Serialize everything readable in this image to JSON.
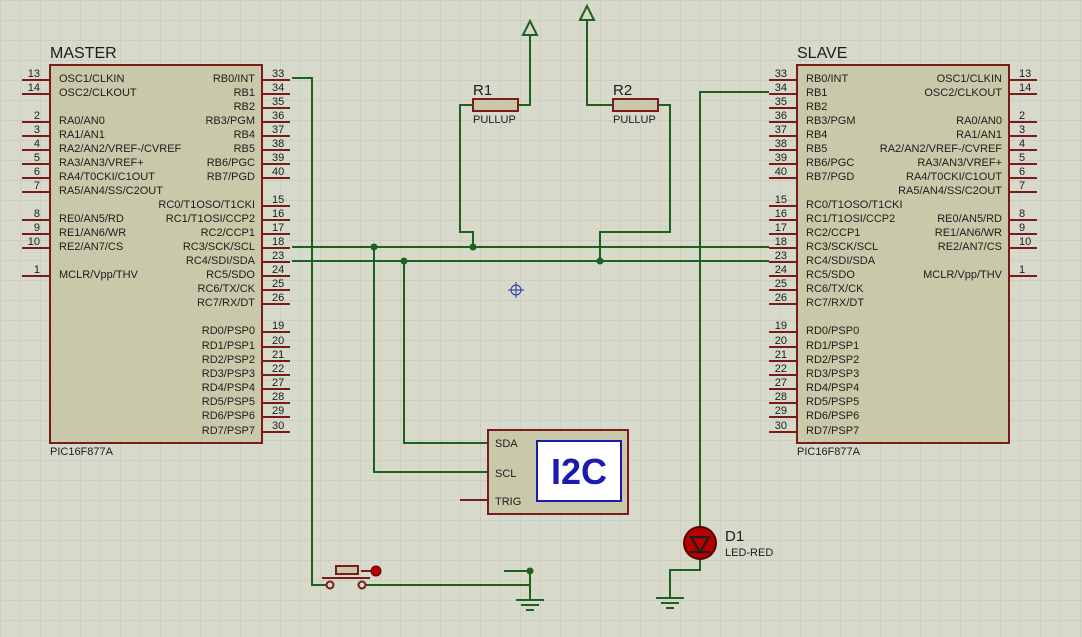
{
  "master": {
    "name": "MASTER",
    "part": "PIC16F877A",
    "left_pins": [
      {
        "num": "13",
        "label": "OSC1/CLKIN",
        "bar": false
      },
      {
        "num": "14",
        "label": "OSC2/CLKOUT",
        "bar": false
      },
      {
        "num": "2",
        "label": "RA0/AN0",
        "bar": false
      },
      {
        "num": "3",
        "label": "RA1/AN1",
        "bar": false
      },
      {
        "num": "4",
        "label": "RA2/AN2/VREF-/CVREF",
        "bar": false
      },
      {
        "num": "5",
        "label": "RA3/AN3/VREF+",
        "bar": false
      },
      {
        "num": "6",
        "label": "RA4/T0CKI/C1OUT",
        "bar": false
      },
      {
        "num": "7",
        "label": "RA5/AN4/SS/C2OUT",
        "bar": false
      },
      {
        "num": "8",
        "label": "RE0/AN5/RD",
        "bar": false
      },
      {
        "num": "9",
        "label": "RE1/AN6/WR",
        "bar": false
      },
      {
        "num": "10",
        "label": "RE2/AN7/CS",
        "bar": false
      },
      {
        "num": "1",
        "label": "MCLR/Vpp/THV",
        "bar": false
      }
    ],
    "right_pins": [
      {
        "num": "33",
        "label": "RB0/INT"
      },
      {
        "num": "34",
        "label": "RB1"
      },
      {
        "num": "35",
        "label": "RB2"
      },
      {
        "num": "36",
        "label": "RB3/PGM"
      },
      {
        "num": "37",
        "label": "RB4"
      },
      {
        "num": "38",
        "label": "RB5"
      },
      {
        "num": "39",
        "label": "RB6/PGC"
      },
      {
        "num": "40",
        "label": "RB7/PGD"
      },
      {
        "num": "15",
        "label": "RC0/T1OSO/T1CKI"
      },
      {
        "num": "16",
        "label": "RC1/T1OSI/CCP2"
      },
      {
        "num": "17",
        "label": "RC2/CCP1"
      },
      {
        "num": "18",
        "label": "RC3/SCK/SCL"
      },
      {
        "num": "23",
        "label": "RC4/SDI/SDA"
      },
      {
        "num": "24",
        "label": "RC5/SDO"
      },
      {
        "num": "25",
        "label": "RC6/TX/CK"
      },
      {
        "num": "26",
        "label": "RC7/RX/DT"
      },
      {
        "num": "19",
        "label": "RD0/PSP0"
      },
      {
        "num": "20",
        "label": "RD1/PSP1"
      },
      {
        "num": "21",
        "label": "RD2/PSP2"
      },
      {
        "num": "22",
        "label": "RD3/PSP3"
      },
      {
        "num": "27",
        "label": "RD4/PSP4"
      },
      {
        "num": "28",
        "label": "RD5/PSP5"
      },
      {
        "num": "29",
        "label": "RD6/PSP6"
      },
      {
        "num": "30",
        "label": "RD7/PSP7"
      }
    ]
  },
  "slave": {
    "name": "SLAVE",
    "part": "PIC16F877A"
  },
  "resistors": [
    {
      "ref": "R1",
      "value": "PULLUP"
    },
    {
      "ref": "R2",
      "value": "PULLUP"
    }
  ],
  "i2c": {
    "title": "I2C",
    "pins": [
      "SDA",
      "SCL",
      "TRIG"
    ]
  },
  "led": {
    "ref": "D1",
    "value": "LED-RED"
  },
  "colors": {
    "background": "#d7d9cb",
    "grid": "#c4c6b8",
    "chip_fill": "#c9c9aa",
    "chip_border": "#7a1a1a",
    "wire": "#1f5f1f",
    "i2c_text": "#1b1bb0",
    "led": "#b30000"
  }
}
